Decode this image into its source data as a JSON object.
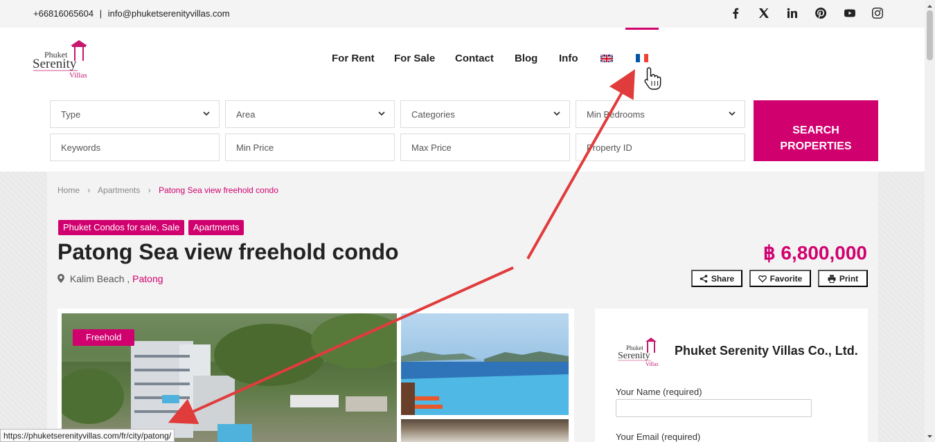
{
  "topbar": {
    "phone": "+66816065604",
    "separator": "|",
    "email": "info@phuketserenityvillas.com",
    "social_icons": [
      "facebook-icon",
      "x-icon",
      "linkedin-icon",
      "pinterest-icon",
      "youtube-icon",
      "instagram-icon"
    ]
  },
  "brand": {
    "accent_color": "#d1006f",
    "logo_line1": "Phuket",
    "logo_line2": "Serenity",
    "logo_line3": "Villas"
  },
  "nav": {
    "items": [
      "For Rent",
      "For Sale",
      "Contact",
      "Blog",
      "Info"
    ],
    "flags": [
      "uk-flag-icon",
      "france-flag-icon"
    ]
  },
  "search": {
    "type": "Type",
    "area": "Area",
    "categories": "Categories",
    "min_bedrooms": "Min Bedrooms",
    "keywords": "Keywords",
    "min_price": "Min Price",
    "max_price": "Max Price",
    "property_id": "Property ID",
    "button_line1": "SEARCH",
    "button_line2": "PROPERTIES"
  },
  "breadcrumb": {
    "home": "Home",
    "category": "Apartments",
    "current": "Patong Sea view freehold condo"
  },
  "property": {
    "tags": [
      "Phuket Condos for sale, Sale",
      "Apartments"
    ],
    "title": "Patong Sea view freehold condo",
    "location": "Kalim Beach ,",
    "city": "Patong",
    "price": "฿ 6,800,000",
    "badge": "Freehold"
  },
  "actions": {
    "share": "Share",
    "favorite": "Favorite",
    "print": "Print"
  },
  "agent": {
    "name": "Phuket Serenity Villas Co., Ltd.",
    "name_label": "Your Name (required)",
    "email_label": "Your Email (required)"
  },
  "status_bar": {
    "url": "https://phuketserenityvillas.com/fr/city/patong/"
  }
}
